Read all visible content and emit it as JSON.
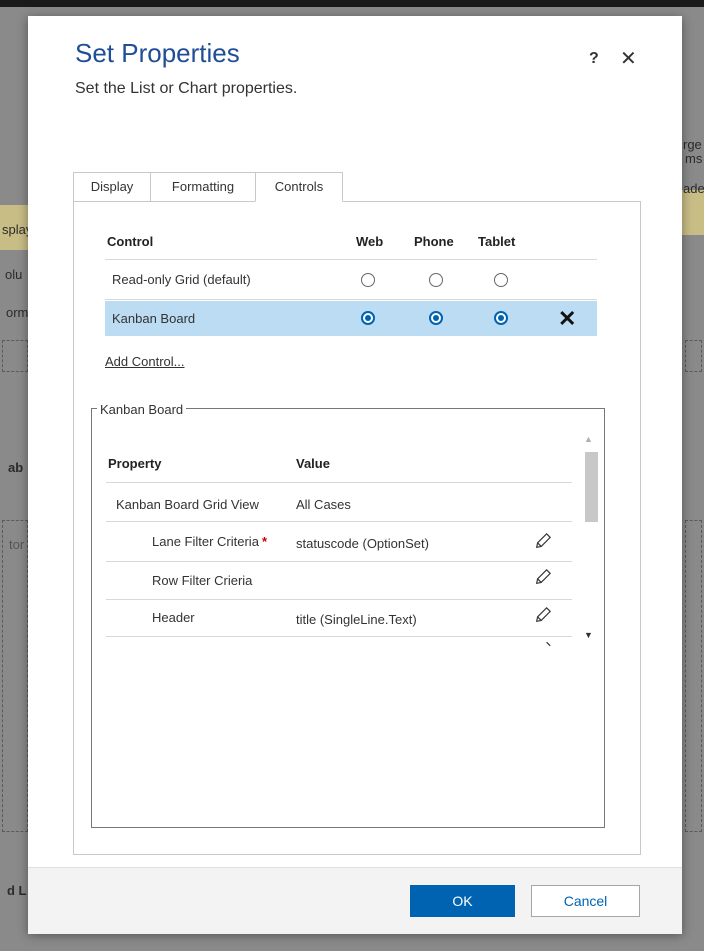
{
  "dialog": {
    "title": "Set Properties",
    "subtitle": "Set the List or Chart properties.",
    "help_label": "?",
    "close_label": "✕"
  },
  "tabs": [
    {
      "label": "Display",
      "active": false
    },
    {
      "label": "Formatting",
      "active": false
    },
    {
      "label": "Controls",
      "active": true
    }
  ],
  "controls_table": {
    "headers": {
      "control": "Control",
      "web": "Web",
      "phone": "Phone",
      "tablet": "Tablet"
    },
    "rows": [
      {
        "name": "Read-only Grid (default)",
        "web": false,
        "phone": false,
        "tablet": false,
        "selected": false
      },
      {
        "name": "Kanban Board",
        "web": true,
        "phone": true,
        "tablet": true,
        "selected": true
      }
    ],
    "remove_label": "✕",
    "add_control_label": "Add Control..."
  },
  "property_group": {
    "legend": "Kanban Board",
    "headers": {
      "property": "Property",
      "value": "Value"
    },
    "rows": [
      {
        "property": "Kanban Board Grid View",
        "value": "All Cases",
        "required": false,
        "editable": false
      },
      {
        "property": "Lane Filter Criteria",
        "value": "statuscode (OptionSet)",
        "required": true,
        "editable": true
      },
      {
        "property": "Row Filter Crieria",
        "value": "",
        "required": false,
        "editable": true
      },
      {
        "property": "Header",
        "value": "title (SingleLine.Text)",
        "required": false,
        "editable": true
      }
    ],
    "required_mark": "*"
  },
  "footer": {
    "ok_label": "OK",
    "cancel_label": "Cancel"
  },
  "background": {
    "fragments": [
      "splay",
      "olu",
      "orm",
      "ab",
      "tor",
      "d L",
      "rge",
      "ms",
      "ade"
    ]
  },
  "colors": {
    "title": "#1f4e97",
    "accent": "#0063b1",
    "selected_row": "#bcdcf4",
    "required": "#cc0000"
  }
}
